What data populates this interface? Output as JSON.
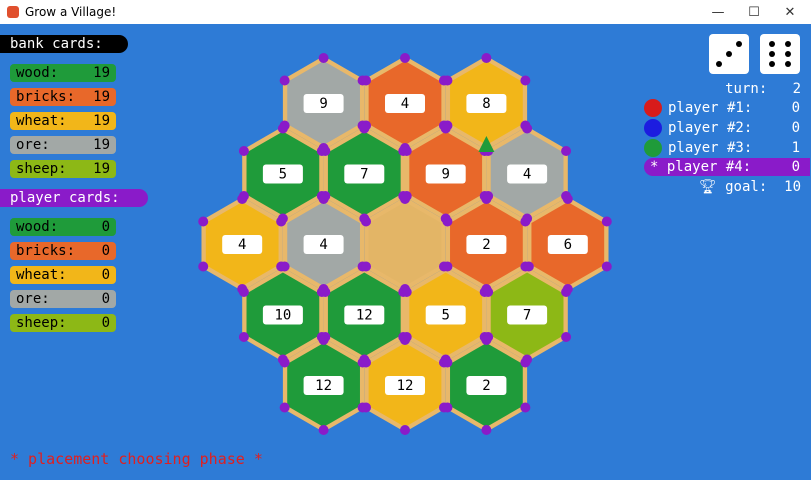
{
  "window": {
    "title": "Grow a Village!",
    "minimize": "—",
    "maximize": "☐",
    "close": "✕"
  },
  "bank": {
    "header": "bank cards:",
    "cards": [
      {
        "name": "wood:",
        "value": "19",
        "color": "#1f9b3a"
      },
      {
        "name": "bricks:",
        "value": "19",
        "color": "#e8682a"
      },
      {
        "name": "wheat:",
        "value": "19",
        "color": "#f2b619"
      },
      {
        "name": "ore:",
        "value": "19",
        "color": "#a2a8a6"
      },
      {
        "name": "sheep:",
        "value": "19",
        "color": "#8db816"
      }
    ]
  },
  "player_cards": {
    "header": "player cards:",
    "cards": [
      {
        "name": "wood:",
        "value": "0",
        "color": "#1f9b3a"
      },
      {
        "name": "bricks:",
        "value": "0",
        "color": "#e8682a"
      },
      {
        "name": "wheat:",
        "value": "0",
        "color": "#f2b619"
      },
      {
        "name": "ore:",
        "value": "0",
        "color": "#a2a8a6"
      },
      {
        "name": "sheep:",
        "value": "0",
        "color": "#8db816"
      }
    ]
  },
  "dice": {
    "die1": 3,
    "die2": 6
  },
  "status": {
    "turn_label": "turn:",
    "turn_value": "2",
    "goal_label": "goal:",
    "goal_value": "10",
    "goal_icon": "trophy-icon"
  },
  "players": [
    {
      "label": "player #1:",
      "score": "0",
      "color": "#d81b1b",
      "active": false
    },
    {
      "label": "player #2:",
      "score": "0",
      "color": "#1c1ce0",
      "active": false
    },
    {
      "label": "player #3:",
      "score": "1",
      "color": "#1f9b3a",
      "active": false
    },
    {
      "label": "player #4:",
      "score": "0",
      "color": "#8a1bc9",
      "active": true,
      "marker": "*"
    }
  ],
  "board": {
    "tiles": [
      {
        "row": 0,
        "col": 0,
        "resource": "ore",
        "number": "9"
      },
      {
        "row": 0,
        "col": 1,
        "resource": "bricks",
        "number": "4"
      },
      {
        "row": 0,
        "col": 2,
        "resource": "wheat",
        "number": "8"
      },
      {
        "row": 1,
        "col": 0,
        "resource": "wood",
        "number": "5"
      },
      {
        "row": 1,
        "col": 1,
        "resource": "wood",
        "number": "7"
      },
      {
        "row": 1,
        "col": 2,
        "resource": "bricks",
        "number": "9"
      },
      {
        "row": 1,
        "col": 3,
        "resource": "ore",
        "number": "4"
      },
      {
        "row": 2,
        "col": 0,
        "resource": "wheat",
        "number": "4"
      },
      {
        "row": 2,
        "col": 1,
        "resource": "ore",
        "number": "4"
      },
      {
        "row": 2,
        "col": 2,
        "resource": "desert",
        "number": ""
      },
      {
        "row": 2,
        "col": 3,
        "resource": "bricks",
        "number": "2"
      },
      {
        "row": 2,
        "col": 4,
        "resource": "bricks",
        "number": "6"
      },
      {
        "row": 3,
        "col": 0,
        "resource": "wood",
        "number": "10"
      },
      {
        "row": 3,
        "col": 1,
        "resource": "wood",
        "number": "12"
      },
      {
        "row": 3,
        "col": 2,
        "resource": "wheat",
        "number": "5"
      },
      {
        "row": 3,
        "col": 3,
        "resource": "sheep",
        "number": "7"
      },
      {
        "row": 4,
        "col": 0,
        "resource": "wood",
        "number": "12"
      },
      {
        "row": 4,
        "col": 1,
        "resource": "wheat",
        "number": "12"
      },
      {
        "row": 4,
        "col": 2,
        "resource": "wood",
        "number": "2"
      }
    ],
    "colors": {
      "wood": "#1f9b3a",
      "bricks": "#e8682a",
      "wheat": "#f2b619",
      "ore": "#a2a8a6",
      "sheep": "#8db816",
      "desert": "#e3b566",
      "border": "#e8b86a",
      "vertex": "#8a1bc9",
      "settlement": "#1f9b3a"
    },
    "settlement": {
      "player": "player #3",
      "color": "#1f9b3a"
    }
  },
  "phase": "* placement choosing phase *"
}
